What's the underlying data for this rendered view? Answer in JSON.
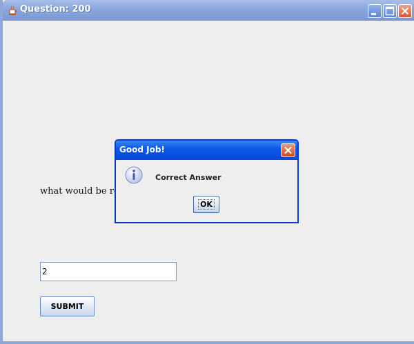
{
  "window": {
    "title": "Question: 200",
    "icon": "java-cup-icon",
    "controls": [
      "minimize-icon",
      "maximize-icon",
      "close-icon"
    ]
  },
  "main": {
    "question_text": "what would be retu",
    "answer_value": "2",
    "submit_label": "SUBMIT"
  },
  "dialog": {
    "title": "Good Job!",
    "icon": "info-icon",
    "message": "Correct Answer",
    "ok_label": "OK"
  }
}
